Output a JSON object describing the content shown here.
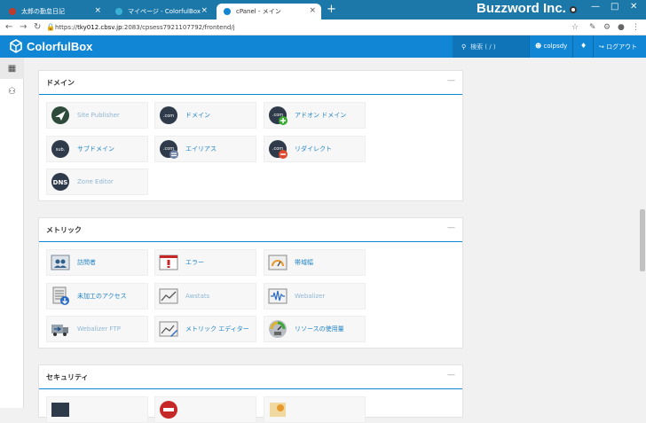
{
  "browser": {
    "tabs": [
      {
        "title": "太郎の勤怠日記",
        "active": false,
        "fav": "#c0392b"
      },
      {
        "title": "マイページ - ColorfulBox",
        "active": false,
        "fav": "#3bb0d6"
      },
      {
        "title": "cPanel - メイン",
        "active": true,
        "fav": "#1186d4"
      }
    ],
    "new_tab": "+",
    "window_title": "Buzzword Inc.",
    "url_prefix": "https://",
    "url_host": "tky012.cbsv.jp",
    "url_path": ":2083/cpsess7921107792/frontend/j"
  },
  "header": {
    "brand": "ColorfulBox",
    "search_placeholder": "検索 ( / )",
    "user": "colpsdy",
    "logout": "ログアウト"
  },
  "sections": [
    {
      "title": "ドメイン",
      "items": [
        {
          "label": "Site Publisher",
          "icon": "site-publisher",
          "dim": true
        },
        {
          "label": "ドメイン",
          "icon": "com",
          "dim": false
        },
        {
          "label": "アドオン ドメイン",
          "icon": "com-add",
          "dim": false
        },
        {
          "label": "サブドメイン",
          "icon": "sub",
          "dim": false
        },
        {
          "label": "エイリアス",
          "icon": "com-alias",
          "dim": false
        },
        {
          "label": "リダイレクト",
          "icon": "com-redirect",
          "dim": false
        },
        {
          "label": "Zone Editor",
          "icon": "dns",
          "dim": true
        }
      ]
    },
    {
      "title": "メトリック",
      "items": [
        {
          "label": "訪問者",
          "icon": "visitors",
          "dim": false
        },
        {
          "label": "エラー",
          "icon": "errors",
          "dim": false
        },
        {
          "label": "帯域幅",
          "icon": "bandwidth",
          "dim": false
        },
        {
          "label": "未加工のアクセス",
          "icon": "raw-access",
          "dim": false
        },
        {
          "label": "Awstats",
          "icon": "awstats",
          "dim": true
        },
        {
          "label": "Webalizer",
          "icon": "webalizer",
          "dim": true
        },
        {
          "label": "Webalizer FTP",
          "icon": "webalizer-ftp",
          "dim": true
        },
        {
          "label": "メトリック エディター",
          "icon": "metrics-editor",
          "dim": false
        },
        {
          "label": "リソースの使用量",
          "icon": "resource-usage",
          "dim": false
        }
      ]
    },
    {
      "title": "セキュリティ",
      "items": []
    }
  ]
}
